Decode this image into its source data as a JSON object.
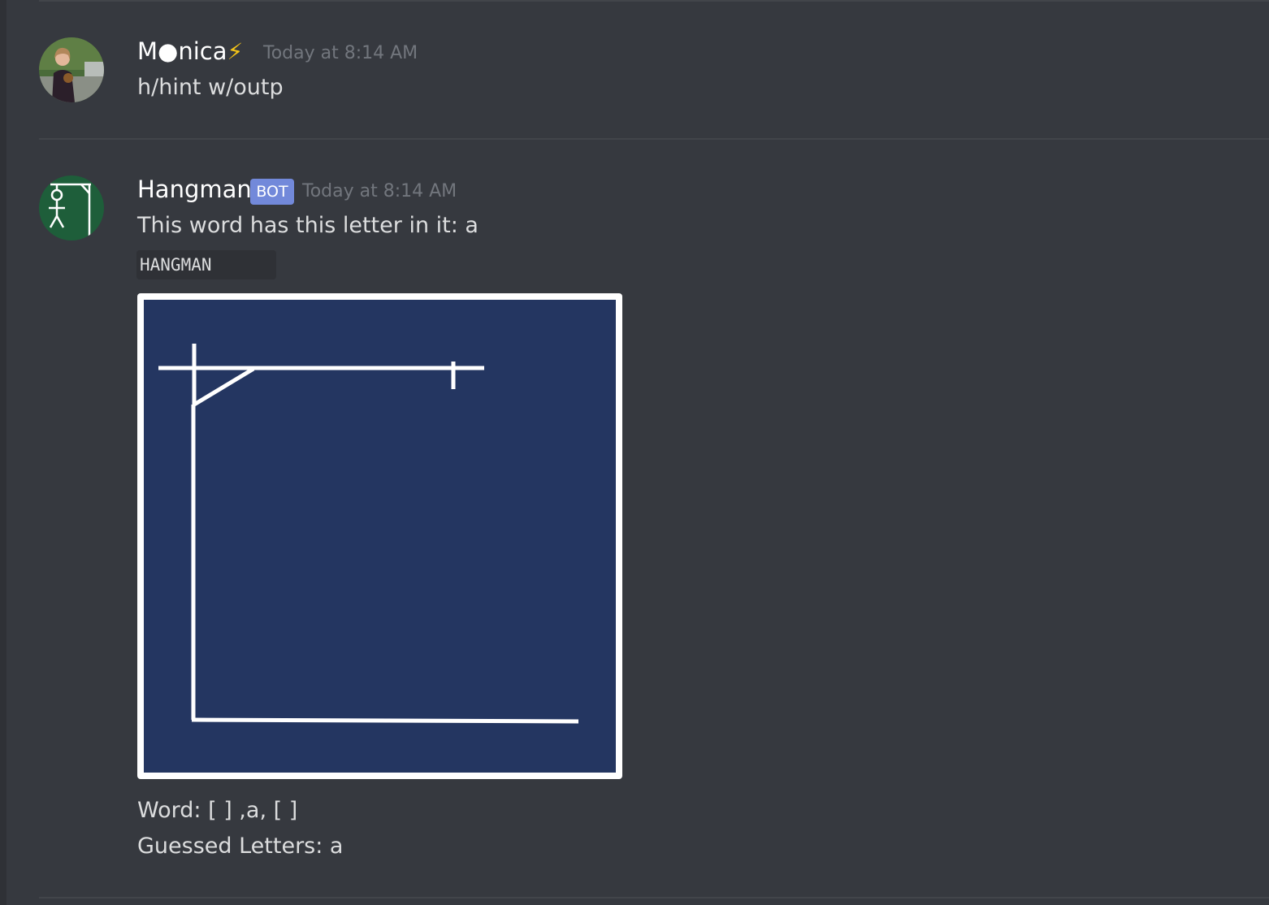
{
  "messages": [
    {
      "author": "M●nica",
      "author_emoji": "⚡",
      "timestamp": "Today at 8:14 AM",
      "content": "h/hint w/outp",
      "avatar": "user-photo-avatar"
    },
    {
      "author": "Hangman",
      "badge": "BOT",
      "timestamp": "Today at 8:14 AM",
      "content": "This word has this letter in it: a",
      "code_block": "HANGMAN",
      "avatar": "stick-figure-gallows-avatar",
      "image": "hangman-gallows-empty",
      "word_line": "Word:  [ ] ,a, [ ]",
      "guessed_line": "Guessed Letters: a"
    }
  ],
  "colors": {
    "background": "#36393f",
    "username": "#ffffff",
    "timestamp": "#72767d",
    "text": "#dcddde",
    "bot_badge": "#7289da",
    "hangman_board": "#243661",
    "hangman_avatar": "#1e5e3a"
  }
}
